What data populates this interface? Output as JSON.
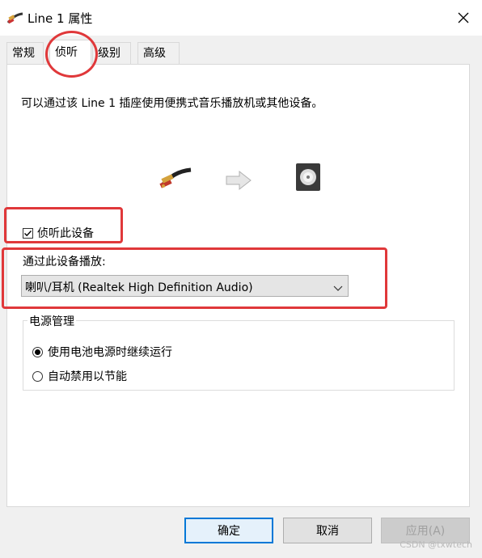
{
  "window": {
    "title": "Line 1 属性",
    "close_icon": "close-icon"
  },
  "tabs": [
    {
      "label": "常规",
      "active": false
    },
    {
      "label": "侦听",
      "active": true
    },
    {
      "label": "级别",
      "active": false
    },
    {
      "label": "高级",
      "active": false
    }
  ],
  "listen": {
    "description": "可以通过该 Line 1 插座使用便携式音乐播放机或其他设备。",
    "checkbox_label": "侦听此设备",
    "checkbox_checked": true,
    "playback_label": "通过此设备播放:",
    "playback_device": "喇叭/耳机 (Realtek High Definition Audio)"
  },
  "power": {
    "group_title": "电源管理",
    "options": [
      {
        "label": "使用电池电源时继续运行",
        "checked": true
      },
      {
        "label": "自动禁用以节能",
        "checked": false
      }
    ]
  },
  "buttons": {
    "ok": "确定",
    "cancel": "取消",
    "apply": "应用(A)"
  },
  "watermark": "CSDN @txwtech",
  "colors": {
    "annotation": "#e0383a",
    "default_button_border": "#0078d7"
  }
}
